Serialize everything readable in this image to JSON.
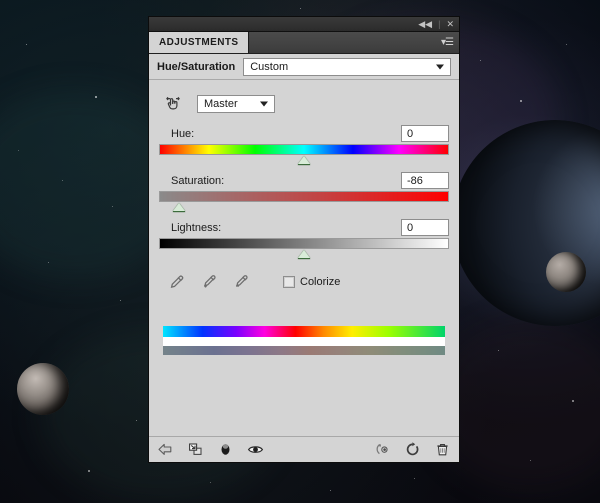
{
  "window": {
    "titlebar": {
      "collapse_icon": "collapse-to-icons",
      "collapse_glyph": "◀◀",
      "separator": "|",
      "close_icon": "close-panel",
      "close_glyph": "✕"
    },
    "tab": {
      "label": "ADJUSTMENTS",
      "menu_icon": "panel-menu-icon",
      "menu_glyph": "▾☰"
    }
  },
  "preset": {
    "title": "Hue/Saturation",
    "value": "Custom",
    "caret_icon": "chevron-down-icon"
  },
  "channel": {
    "scrubby_icon": "on-image-adjustment-icon",
    "value": "Master",
    "caret_icon": "chevron-down-icon"
  },
  "sliders": [
    {
      "name": "hue",
      "label": "Hue:",
      "value": "0",
      "thumb_percent": 50,
      "range": [
        -180,
        180
      ]
    },
    {
      "name": "saturation",
      "label": "Saturation:",
      "value": "-86",
      "thumb_percent": 7,
      "range": [
        -100,
        100
      ]
    },
    {
      "name": "lightness",
      "label": "Lightness:",
      "value": "0",
      "thumb_percent": 50,
      "range": [
        -100,
        100
      ]
    }
  ],
  "tools": {
    "eyedroppers": [
      {
        "name": "eyedropper-sample",
        "title": "Sample color"
      },
      {
        "name": "eyedropper-add",
        "title": "Add to sample"
      },
      {
        "name": "eyedropper-subtract",
        "title": "Subtract from sample"
      }
    ],
    "colorize": {
      "label": "Colorize",
      "checked": false
    }
  },
  "spectrum": {
    "top_name": "input-color-spectrum",
    "bottom_name": "output-color-spectrum"
  },
  "footer": {
    "left": [
      {
        "name": "return-to-adjustment-list-button",
        "icon": "back-arrow-icon"
      },
      {
        "name": "clip-to-layer-button",
        "icon": "clip-to-layer-icon"
      },
      {
        "name": "toggle-mask-button",
        "icon": "mask-icon"
      },
      {
        "name": "toggle-layer-visibility-button",
        "icon": "eye-icon"
      }
    ],
    "right": [
      {
        "name": "preview-previous-state-button",
        "icon": "previous-state-icon"
      },
      {
        "name": "reset-adjustment-button",
        "icon": "reset-icon"
      },
      {
        "name": "delete-adjustment-layer-button",
        "icon": "trash-icon"
      }
    ]
  },
  "colors": {
    "panel_background": "#d4d4d4",
    "titlebar": "#2b2b2b",
    "tabbar": "#3f3f3f",
    "thumb": "#d8ecd8",
    "desktop": "#07070d"
  }
}
